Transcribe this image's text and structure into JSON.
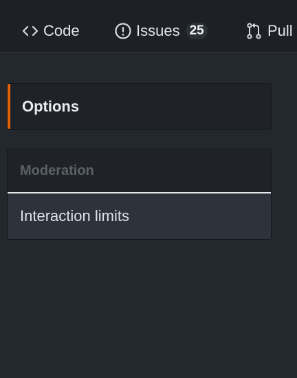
{
  "nav": {
    "tabs": [
      {
        "label": "Code",
        "icon": "code-icon"
      },
      {
        "label": "Issues",
        "icon": "issue-opened-icon",
        "count": "25"
      },
      {
        "label": "Pull",
        "icon": "git-pull-request-icon"
      }
    ]
  },
  "sidebar": {
    "options_label": "Options",
    "moderation": {
      "heading": "Moderation",
      "items": [
        {
          "label": "Interaction limits"
        }
      ]
    }
  },
  "colors": {
    "background": "#23272e",
    "nav_background": "#1d2025",
    "accent": "#e36209"
  }
}
